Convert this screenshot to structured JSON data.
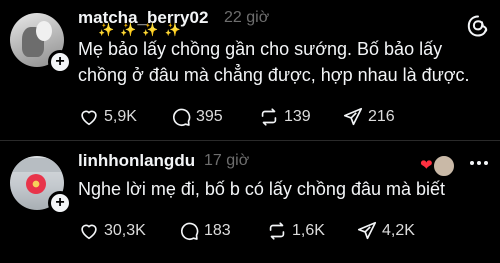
{
  "posts": [
    {
      "username": "matcha_berry02",
      "time": "22 giờ",
      "sparkles": "✨✨✨✨",
      "text": "Mẹ bảo lấy chồng gần cho sướng. Bố bảo lấy chồng ở đâu mà chẳng được, hợp nhau là được.",
      "likes": "5,9K",
      "replies": "395",
      "reposts": "139",
      "shares": "216"
    },
    {
      "username": "linhhonlangdu",
      "time": "17 giờ",
      "text": "Nghe lời mẹ đi, bố b có lấy chồng đâu mà biết",
      "likes": "30,3K",
      "replies": "183",
      "reposts": "1,6K",
      "shares": "4,2K"
    }
  ],
  "icons": {
    "threads": "threads-logo-icon",
    "like": "heart-icon",
    "reply": "comment-icon",
    "repost": "repost-icon",
    "share": "send-icon"
  },
  "colors": {
    "background": "#000000",
    "text": "#f3f5f7",
    "muted": "#6e6e6e",
    "like_red": "#ff3040"
  }
}
